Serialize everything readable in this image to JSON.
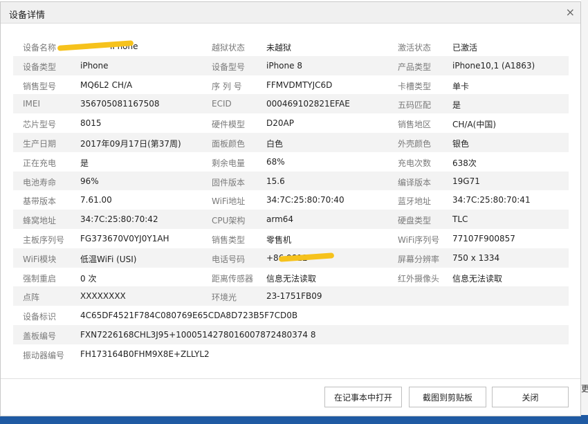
{
  "dialog": {
    "title": "设备详情",
    "close_glyph": "×"
  },
  "rows": [
    [
      [
        "设备名称",
        "iPhone"
      ],
      [
        "越狱状态",
        "未越狱"
      ],
      [
        "激活状态",
        "已激活"
      ]
    ],
    [
      [
        "设备类型",
        "iPhone"
      ],
      [
        "设备型号",
        "iPhone 8"
      ],
      [
        "产品类型",
        "iPhone10,1 (A1863)"
      ]
    ],
    [
      [
        "销售型号",
        "MQ6L2 CH/A"
      ],
      [
        "序 列 号",
        "FFMVDMTYJC6D"
      ],
      [
        "卡槽类型",
        "单卡"
      ]
    ],
    [
      [
        "IMEI",
        "356705081167508"
      ],
      [
        "ECID",
        "000469102821EFAE"
      ],
      [
        "五码匹配",
        "是"
      ]
    ],
    [
      [
        "芯片型号",
        "8015"
      ],
      [
        "硬件模型",
        "D20AP"
      ],
      [
        "销售地区",
        "CH/A(中国)"
      ]
    ],
    [
      [
        "生产日期",
        "2017年09月17日(第37周)"
      ],
      [
        "面板颜色",
        "白色"
      ],
      [
        "外壳颜色",
        "银色"
      ]
    ],
    [
      [
        "正在充电",
        "是"
      ],
      [
        "剩余电量",
        "68%"
      ],
      [
        "充电次数",
        "638次"
      ]
    ],
    [
      [
        "电池寿命",
        "96%"
      ],
      [
        "固件版本",
        "15.6"
      ],
      [
        "编译版本",
        "19G71"
      ]
    ],
    [
      [
        "基带版本",
        "7.61.00"
      ],
      [
        "WiFi地址",
        "34:7C:25:80:70:40"
      ],
      [
        "蓝牙地址",
        "34:7C:25:80:70:41"
      ]
    ],
    [
      [
        "蜂窝地址",
        "34:7C:25:80:70:42"
      ],
      [
        "CPU架构",
        "arm64"
      ],
      [
        "硬盘类型",
        "TLC"
      ]
    ],
    [
      [
        "主板序列号",
        "FG373670V0YJ0Y1AH"
      ],
      [
        "销售类型",
        "零售机"
      ],
      [
        "WiFi序列号",
        "77107F900857"
      ]
    ],
    [
      [
        "WiFi模块",
        "低温WiFi (USI)"
      ],
      [
        "电话号码",
        "+86       9812"
      ],
      [
        "屏幕分辨率",
        "750 x 1334"
      ]
    ],
    [
      [
        "强制重启",
        "0 次"
      ],
      [
        "距离传感器",
        "信息无法读取"
      ],
      [
        "红外摄像头",
        "信息无法读取"
      ]
    ],
    [
      [
        "点阵",
        "XXXXXXXX"
      ],
      [
        "环境光",
        "23-1751FB09"
      ],
      [
        "",
        ""
      ]
    ],
    [
      [
        "设备标识",
        "4C65DF4521F784C080769E65CDA8D723B5F7CD0B"
      ],
      [
        "",
        ""
      ],
      [
        "",
        ""
      ]
    ],
    [
      [
        "盖板编号",
        "FXN7226168CHL3J95+1000514278016007872480374 8"
      ],
      [
        "",
        ""
      ],
      [
        "",
        ""
      ]
    ],
    [
      [
        "振动器编号",
        "FH173164B0FHM9X8E+ZLLYL2"
      ],
      [
        "",
        ""
      ],
      [
        "",
        ""
      ]
    ]
  ],
  "buttons": {
    "open_notepad": "在记事本中打开",
    "screenshot_clipboard": "截图到剪贴板",
    "close": "关闭"
  },
  "background": {
    "right_text": "更"
  },
  "colors": {
    "redaction": "#f6c21c",
    "stripe": "#f3f3f3",
    "label": "#7a7a7a",
    "desktop": "#2f6fb3"
  }
}
